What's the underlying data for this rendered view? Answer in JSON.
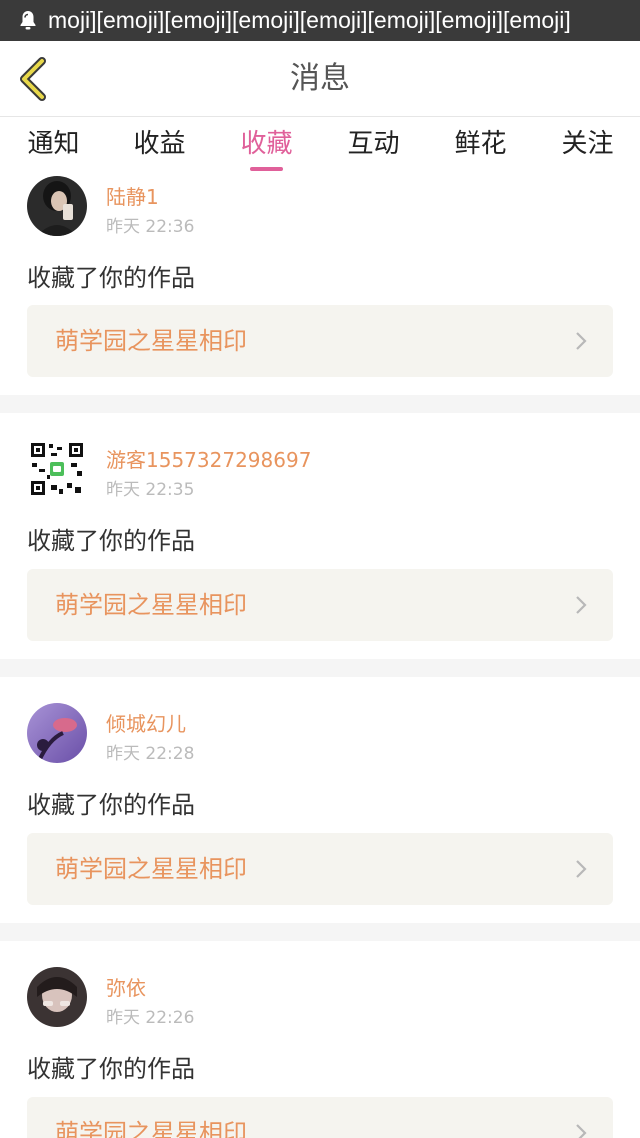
{
  "status_bar": {
    "notification_icon": "notification-bell-icon",
    "ticker_text": "moji][emoji][emoji][emoji][emoji][emoji][emoji][emoji]"
  },
  "header": {
    "back_icon": "back-chevron-icon",
    "title": "消息"
  },
  "tabs": [
    {
      "label": "通知",
      "active": false
    },
    {
      "label": "收益",
      "active": false
    },
    {
      "label": "收藏",
      "active": true
    },
    {
      "label": "互动",
      "active": false
    },
    {
      "label": "鲜花",
      "active": false
    },
    {
      "label": "关注",
      "active": false
    }
  ],
  "feed": [
    {
      "username": "陆静1",
      "time": "昨天 22:36",
      "action": "收藏了你的作品",
      "work_title": "萌学园之星星相印"
    },
    {
      "username": "游客1557327298697",
      "time": "昨天 22:35",
      "action": "收藏了你的作品",
      "work_title": "萌学园之星星相印"
    },
    {
      "username": "倾城幻儿",
      "time": "昨天 22:28",
      "action": "收藏了你的作品",
      "work_title": "萌学园之星星相印"
    },
    {
      "username": "弥依",
      "time": "昨天 22:26",
      "action": "收藏了你的作品",
      "work_title": "萌学园之星星相印"
    }
  ],
  "colors": {
    "accent_pink": "#e0609a",
    "username_orange": "#e8945e",
    "back_chevron_yellow": "#e8d84a",
    "work_card_bg": "#f5f4ef"
  }
}
